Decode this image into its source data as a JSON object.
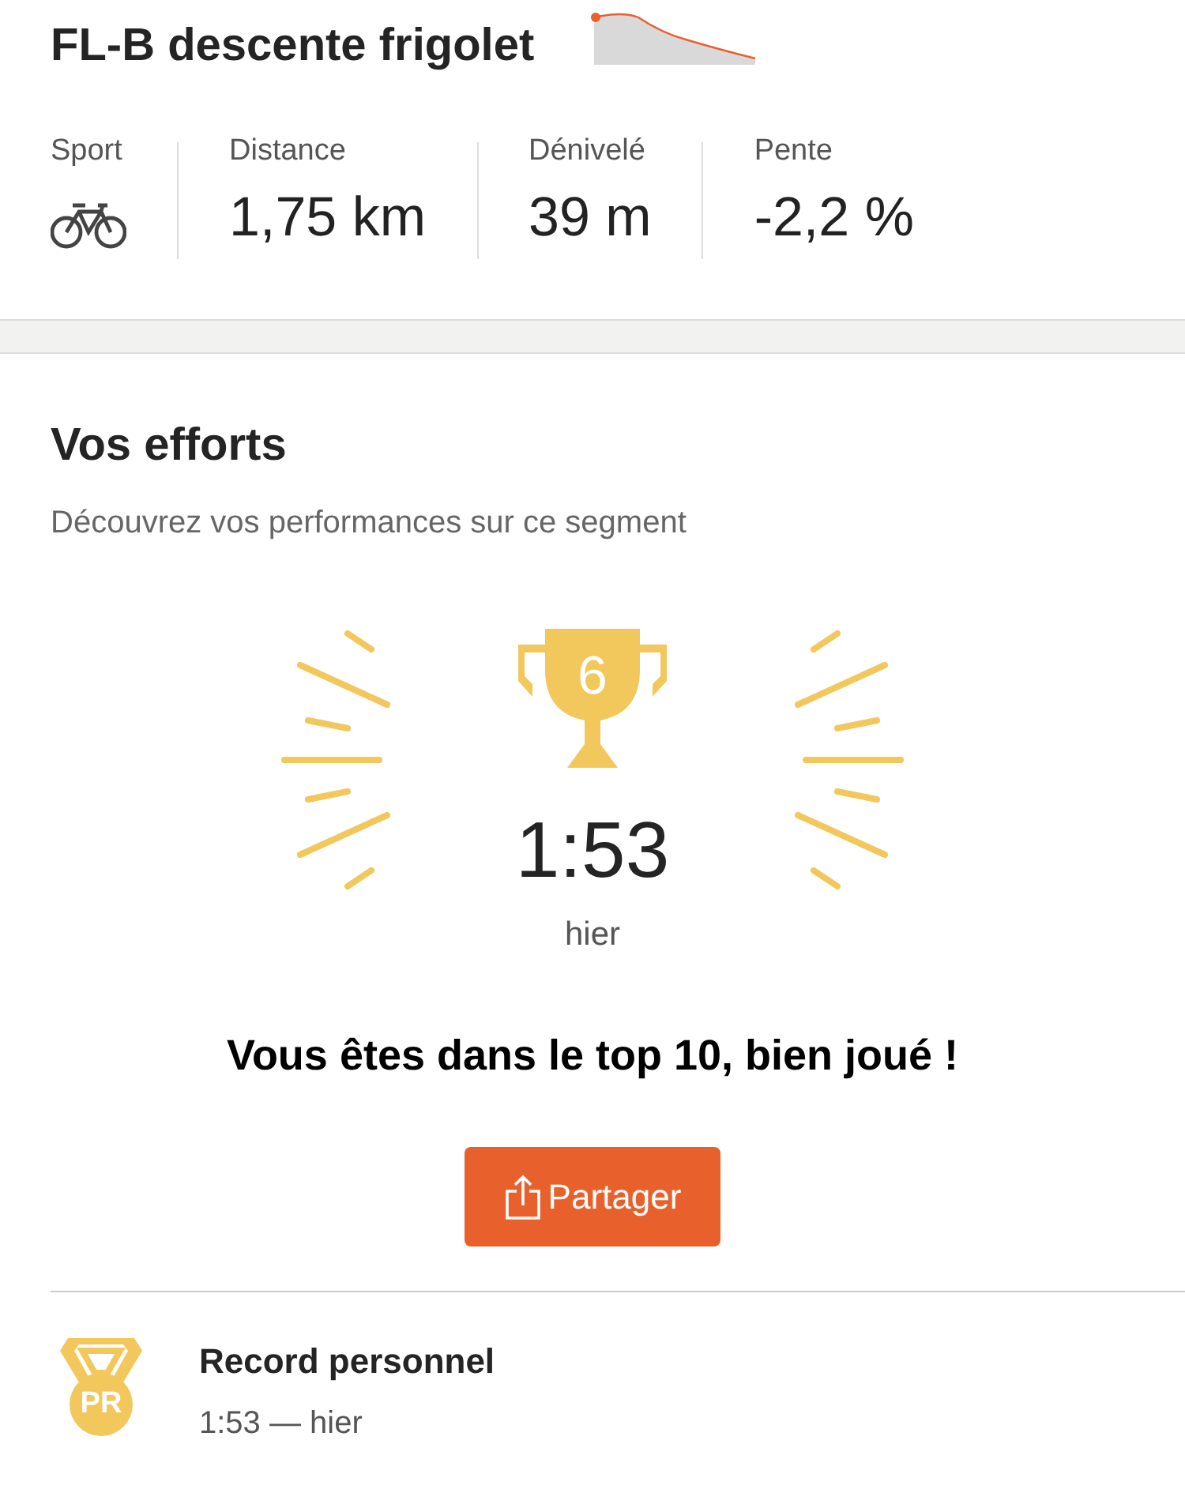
{
  "segment": {
    "title": "FL-B descente frigolet"
  },
  "stats": [
    {
      "label": "Sport",
      "kind": "icon"
    },
    {
      "label": "Distance",
      "kind": "value",
      "value": "1,75 km"
    },
    {
      "label": "Dénivelé",
      "kind": "value",
      "value": "39 m"
    },
    {
      "label": "Pente",
      "kind": "value",
      "value": "-2,2 %"
    }
  ],
  "efforts": {
    "title": "Vos efforts",
    "subtitle": "Découvrez vos performances sur ce segment",
    "rank": "6",
    "time": "1:53",
    "date": "hier",
    "message": "Vous êtes dans le top 10, bien joué !",
    "share_button": "Partager"
  },
  "records": [
    {
      "badge": "PR",
      "title": "Record personnel",
      "detail": "1:53 — hier"
    }
  ]
}
